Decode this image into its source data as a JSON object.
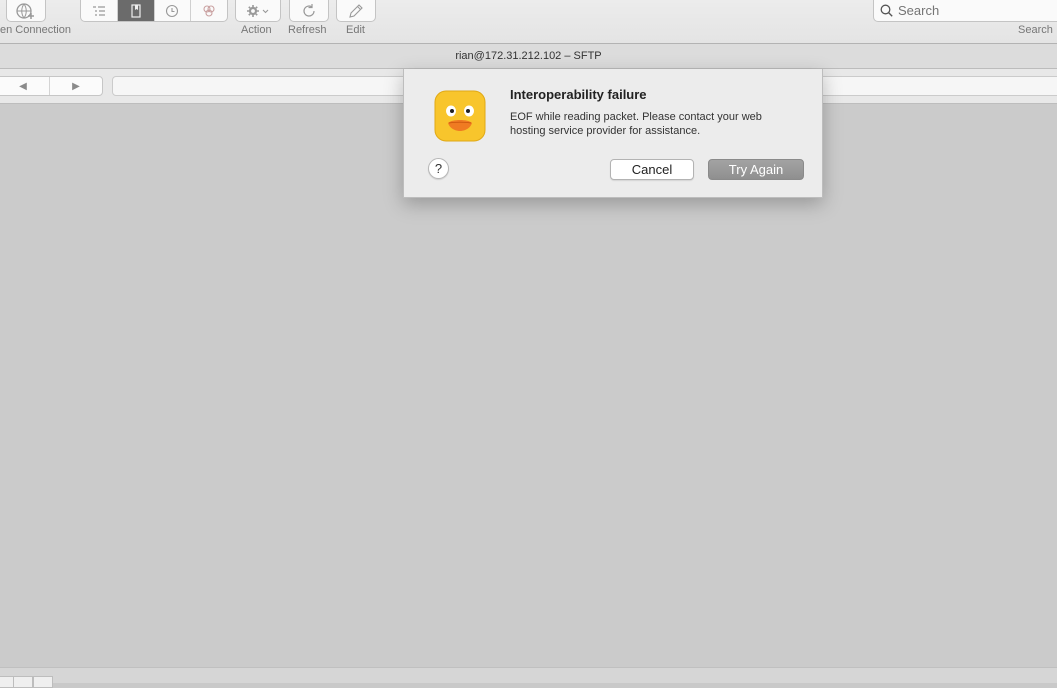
{
  "toolbar": {
    "open_connection_label": "en Connection",
    "action_label": "Action",
    "refresh_label": "Refresh",
    "edit_label": "Edit",
    "search_placeholder": "Search",
    "search_label": "Search"
  },
  "window": {
    "title": "rian@172.31.212.102 – SFTP"
  },
  "dialog": {
    "title": "Interoperability failure",
    "message": "EOF while reading packet. Please contact your web hosting service provider for assistance.",
    "help_label": "?",
    "cancel_label": "Cancel",
    "try_again_label": "Try Again"
  },
  "colors": {
    "accent_default_button": "#999999",
    "icon_yellow": "#f8c52c",
    "icon_orange": "#f07b22"
  }
}
